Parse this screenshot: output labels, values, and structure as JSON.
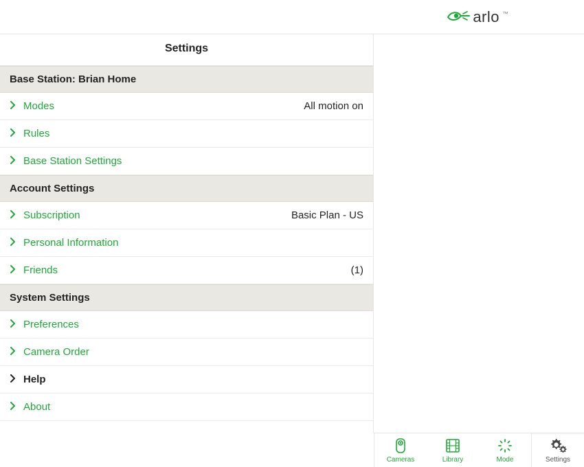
{
  "brand": {
    "name": "arlo"
  },
  "page_title": "Settings",
  "sections": [
    {
      "header": "Base Station: Brian Home",
      "items": [
        {
          "label": "Modes",
          "value": "All motion on",
          "style": "green"
        },
        {
          "label": "Rules",
          "value": "",
          "style": "green"
        },
        {
          "label": "Base Station Settings",
          "value": "",
          "style": "green"
        }
      ]
    },
    {
      "header": "Account Settings",
      "items": [
        {
          "label": "Subscription",
          "value": "Basic Plan - US",
          "style": "green"
        },
        {
          "label": "Personal Information",
          "value": "",
          "style": "green"
        },
        {
          "label": "Friends",
          "value": "(1)",
          "style": "green"
        }
      ]
    },
    {
      "header": "System Settings",
      "items": [
        {
          "label": "Preferences",
          "value": "",
          "style": "green"
        },
        {
          "label": "Camera Order",
          "value": "",
          "style": "green"
        },
        {
          "label": "Help",
          "value": "",
          "style": "black"
        },
        {
          "label": "About",
          "value": "",
          "style": "green"
        }
      ]
    }
  ],
  "toolbar": {
    "items": [
      {
        "label": "Cameras",
        "icon": "camera-icon",
        "active": false
      },
      {
        "label": "Library",
        "icon": "film-icon",
        "active": false
      },
      {
        "label": "Mode",
        "icon": "spinner-icon",
        "active": false
      },
      {
        "label": "Settings",
        "icon": "gear-icon",
        "active": true
      }
    ]
  },
  "colors": {
    "accent": "#1ea838"
  }
}
